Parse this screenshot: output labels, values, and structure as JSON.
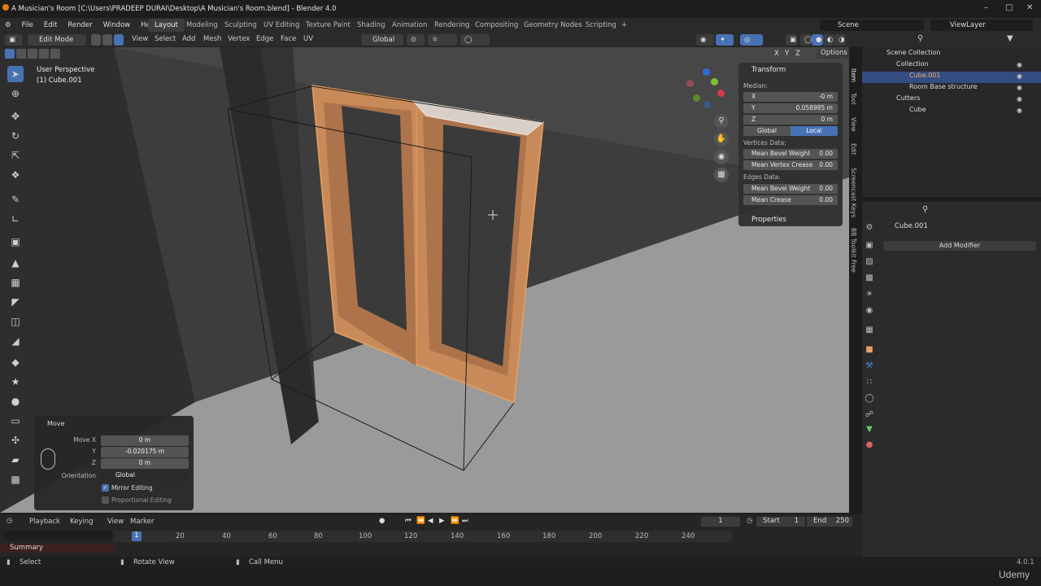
{
  "window": {
    "title": "A Musician's Room [C:\\Users\\PRADEEP DURAI\\Desktop\\A Musician's Room.blend] - Blender 4.0"
  },
  "menu": [
    "File",
    "Edit",
    "Render",
    "Window",
    "Help"
  ],
  "workspaces": [
    "Layout",
    "Modeling",
    "Sculpting",
    "UV Editing",
    "Texture Paint",
    "Shading",
    "Animation",
    "Rendering",
    "Compositing",
    "Geometry Nodes",
    "Scripting"
  ],
  "scene": {
    "label": "Scene",
    "viewlayer": "ViewLayer"
  },
  "header": {
    "mode": "Edit Mode",
    "items": [
      "View",
      "Select",
      "Add",
      "Mesh",
      "Vertex",
      "Edge",
      "Face",
      "UV"
    ],
    "orientation": "Global",
    "options": "Options",
    "axes": [
      "X",
      "Y",
      "Z"
    ]
  },
  "viewport": {
    "perspective": "User Perspective",
    "object": "(1) Cube.001"
  },
  "npanel": {
    "title": "Transform",
    "median": "Median:",
    "x_label": "X",
    "x": "-0 m",
    "y_label": "Y",
    "y": "0.058985 m",
    "z_label": "Z",
    "z": "0 m",
    "global": "Global",
    "local": "Local",
    "vertices_data": "Vertices Data:",
    "mean_bevel": "Mean Bevel Weight",
    "mean_bevel_val": "0.00",
    "mean_vcrease": "Mean Vertex Crease",
    "mean_vcrease_val": "0.00",
    "edges_data": "Edges Data:",
    "mean_bevel2": "Mean Bevel Weight",
    "mean_bevel2_val": "0.00",
    "mean_crease": "Mean Crease",
    "mean_crease_val": "0.00",
    "properties": "Properties"
  },
  "vtabs": [
    "Item",
    "Tool",
    "View",
    "Edit",
    "Screencast Keys",
    "BB Toolkit Free"
  ],
  "operator": {
    "title": "Move",
    "move_x_label": "Move X",
    "move_x": "0 m",
    "y_label": "Y",
    "y": "-0.020175 m",
    "z_label": "Z",
    "z": "0 m",
    "orientation_label": "Orientation",
    "orientation": "Global",
    "mirror": "Mirror Editing",
    "proportional": "Proportional Editing",
    "mirror_checked": true
  },
  "outliner": {
    "rows": [
      {
        "label": "Scene Collection"
      },
      {
        "label": "Collection"
      },
      {
        "label": "Cube.001"
      },
      {
        "label": "Room Base structure"
      },
      {
        "label": "Cutters"
      },
      {
        "label": "Cube"
      }
    ]
  },
  "props": {
    "object": "Cube.001",
    "add_modifier": "Add Modifier"
  },
  "timeline": {
    "playback": "Playback",
    "keying": "Keying",
    "view": "View",
    "marker": "Marker",
    "frame": "1",
    "start_label": "Start",
    "start": "1",
    "end_label": "End",
    "end": "250",
    "ticks": [
      "1",
      "20",
      "40",
      "60",
      "80",
      "100",
      "120",
      "140",
      "160",
      "180",
      "200",
      "220",
      "240"
    ],
    "summary": "Summary"
  },
  "status": {
    "select": "Select",
    "rotate": "Rotate View",
    "call_menu": "Call Menu",
    "version": "4.0.1"
  },
  "watermark": "Udemy",
  "colors": {
    "accent": "#4772b3",
    "selection": "#e8a060",
    "bg": "#3d3d3d"
  }
}
